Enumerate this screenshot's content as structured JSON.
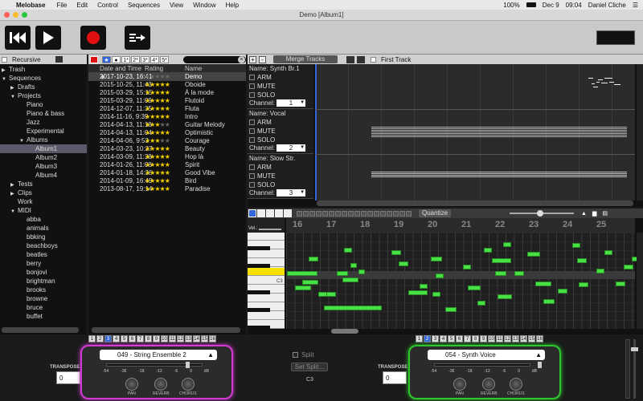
{
  "menubar": {
    "app": "Melobase",
    "items": [
      "File",
      "Edit",
      "Control",
      "Sequences",
      "View",
      "Window",
      "Help"
    ],
    "battery": "100%",
    "date": "Dec 9",
    "time": "09:04",
    "user": "Daniel Cliche"
  },
  "window": {
    "title": "Demo [Album1]"
  },
  "browser": {
    "recursive_label": "Recursive",
    "tree": [
      {
        "label": "Trash",
        "indent": 0,
        "arrow": "▶"
      },
      {
        "label": "Sequences",
        "indent": 0,
        "arrow": "▼"
      },
      {
        "label": "Drafts",
        "indent": 1,
        "arrow": "▶"
      },
      {
        "label": "Projects",
        "indent": 1,
        "arrow": "▼"
      },
      {
        "label": "Piano",
        "indent": 2,
        "arrow": ""
      },
      {
        "label": "Piano & bass",
        "indent": 2,
        "arrow": ""
      },
      {
        "label": "Jazz",
        "indent": 2,
        "arrow": ""
      },
      {
        "label": "Experimental",
        "indent": 2,
        "arrow": ""
      },
      {
        "label": "Albums",
        "indent": 2,
        "arrow": "▼"
      },
      {
        "label": "Album1",
        "indent": 3,
        "arrow": "",
        "selected": true
      },
      {
        "label": "Album2",
        "indent": 3,
        "arrow": ""
      },
      {
        "label": "Album3",
        "indent": 3,
        "arrow": ""
      },
      {
        "label": "Album4",
        "indent": 3,
        "arrow": ""
      },
      {
        "label": "Tests",
        "indent": 1,
        "arrow": "▶"
      },
      {
        "label": "Clips",
        "indent": 1,
        "arrow": "▶"
      },
      {
        "label": "Work",
        "indent": 1,
        "arrow": ""
      },
      {
        "label": "MIDI",
        "indent": 1,
        "arrow": "▼"
      },
      {
        "label": "abba",
        "indent": 2,
        "arrow": ""
      },
      {
        "label": "animals",
        "indent": 2,
        "arrow": ""
      },
      {
        "label": "bbking",
        "indent": 2,
        "arrow": ""
      },
      {
        "label": "beachboys",
        "indent": 2,
        "arrow": ""
      },
      {
        "label": "beatles",
        "indent": 2,
        "arrow": ""
      },
      {
        "label": "berry",
        "indent": 2,
        "arrow": ""
      },
      {
        "label": "bonjovi",
        "indent": 2,
        "arrow": ""
      },
      {
        "label": "brightman",
        "indent": 2,
        "arrow": ""
      },
      {
        "label": "brooks",
        "indent": 2,
        "arrow": ""
      },
      {
        "label": "browne",
        "indent": 2,
        "arrow": ""
      },
      {
        "label": "bruce",
        "indent": 2,
        "arrow": ""
      },
      {
        "label": "buffet",
        "indent": 2,
        "arrow": ""
      }
    ]
  },
  "sequences": {
    "filter_tabs": [
      "★",
      "●",
      "1*",
      "2*",
      "3*",
      "4*",
      "5*"
    ],
    "col_date": "Date and Time ▼",
    "col_rating": "Rating",
    "col_name": "Name",
    "rows": [
      {
        "date": "2017-10-23, 16:41",
        "rating": 0,
        "name": "Demo",
        "selected": true
      },
      {
        "date": "2015-10-25, 11:43",
        "rating": 5,
        "name": "Oboide"
      },
      {
        "date": "2015-03-29, 15:15",
        "rating": 5,
        "name": "À la mode"
      },
      {
        "date": "2015-03-29, 11:09",
        "rating": 5,
        "name": "Flutoid"
      },
      {
        "date": "2014-12-07, 11:35",
        "rating": 5,
        "name": "Fluta"
      },
      {
        "date": "2014-11-16, 9:39",
        "rating": 5,
        "name": "Intro"
      },
      {
        "date": "2014-04-13, 11:18",
        "rating": 3,
        "name": "Guitar Melody"
      },
      {
        "date": "2014-04-13, 11:04",
        "rating": 5,
        "name": "Optimistic"
      },
      {
        "date": "2014-04-06, 9:53",
        "rating": 3,
        "name": "Courage"
      },
      {
        "date": "2014-03-23, 10:27",
        "rating": 5,
        "name": "Beauty"
      },
      {
        "date": "2014-03-09, 11:38",
        "rating": 5,
        "name": "Hop là"
      },
      {
        "date": "2014-01-26, 11:08",
        "rating": 5,
        "name": "Spirit"
      },
      {
        "date": "2014-01-18, 14:36",
        "rating": 5,
        "name": "Good Vibe"
      },
      {
        "date": "2014-01-09, 16:49",
        "rating": 5,
        "name": "Bird"
      },
      {
        "date": "2013-08-17, 19:14",
        "rating": 5,
        "name": "Paradise"
      }
    ]
  },
  "tracks_header": {
    "merge_label": "Merge Tracks",
    "first_track_label": "First Track",
    "add": "+",
    "remove": "-"
  },
  "tracks": [
    {
      "name_label": "Name:",
      "name": "Synth Br.1",
      "arm": "ARM",
      "mute": "MUTE",
      "solo": "SOLO",
      "channel_label": "Channel:",
      "channel": "1"
    },
    {
      "name_label": "Name:",
      "name": "Vocal",
      "arm": "ARM",
      "mute": "MUTE",
      "solo": "SOLO",
      "channel_label": "Channel:",
      "channel": "2"
    },
    {
      "name_label": "Name:",
      "name": "Slow Str.",
      "arm": "ARM",
      "mute": "MUTE",
      "solo": "SOLO",
      "channel_label": "Channel:",
      "channel": "3"
    }
  ],
  "piano_roll": {
    "quantize_label": "Quantize",
    "vel_label": "Vel.:",
    "c3_label": "C3",
    "bars": [
      "16",
      "17",
      "18",
      "19",
      "20",
      "21",
      "22",
      "23",
      "24",
      "25"
    ]
  },
  "bottom": {
    "channel_tabs": [
      "1",
      "2",
      "3",
      "4",
      "5",
      "6",
      "7",
      "8",
      "9",
      "10",
      "11",
      "12",
      "13",
      "14",
      "15",
      "16"
    ],
    "left_active": "3",
    "right_active": "2",
    "left_synth": {
      "patch": "049 - String Ensemble 2",
      "transpose_label": "TRANSPOSE",
      "transpose": "0",
      "pan": "PAN",
      "reverb": "REVERB",
      "chorus": "CHORUS",
      "scale": [
        "-54",
        "-36",
        "-18",
        "-12",
        "-6",
        "0",
        "dB"
      ],
      "color": "#d23bd2"
    },
    "right_synth": {
      "patch": "054 - Synth Voice",
      "transpose_label": "TRANSPOSE",
      "transpose": "0",
      "pan": "PAN",
      "reverb": "REVERB",
      "chorus": "CHORUS",
      "scale": [
        "-54",
        "-36",
        "-18",
        "-12",
        "-6",
        "0",
        "dB"
      ],
      "color": "#2ec52e"
    },
    "split_label": "Split",
    "set_split_label": "Set Split...",
    "split_note": "C3"
  },
  "colors": {
    "accent": "#3366dd",
    "note": "#47e045",
    "record": "#e01010"
  }
}
